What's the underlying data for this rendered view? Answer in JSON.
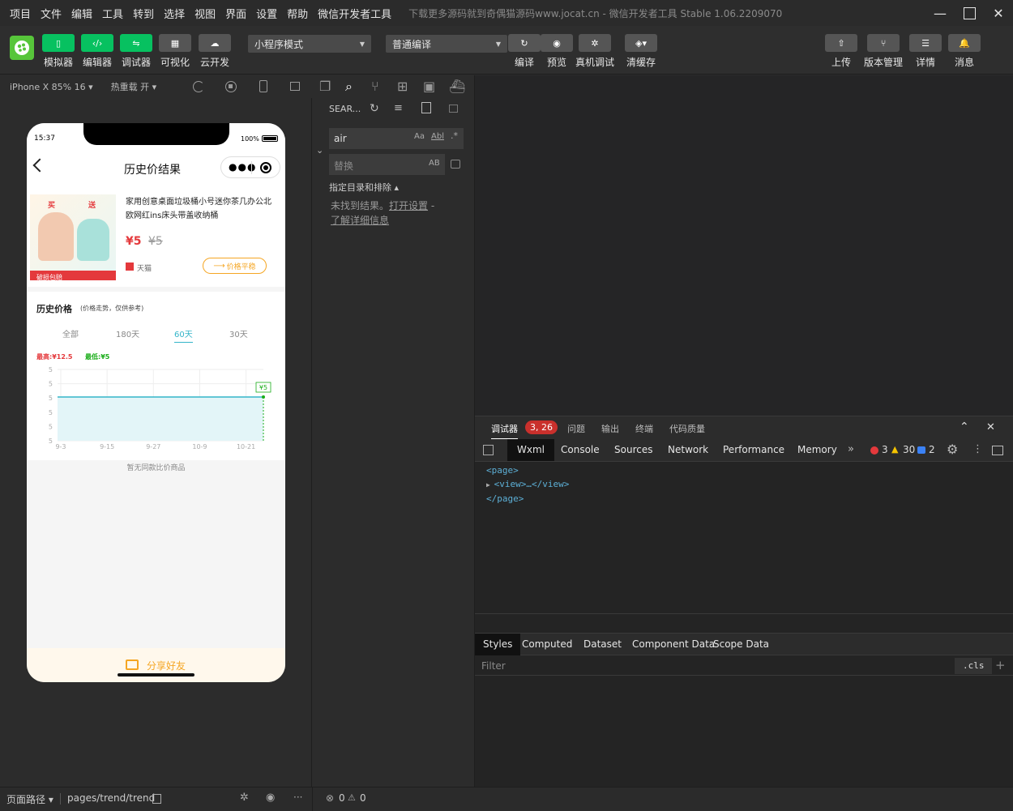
{
  "titlebar": {
    "menus": [
      "项目",
      "文件",
      "编辑",
      "工具",
      "转到",
      "选择",
      "视图",
      "界面",
      "设置",
      "帮助",
      "微信开发者工具"
    ],
    "title": "下载更多源码就到奇偶猫源码www.jocat.cn - 微信开发者工具 Stable 1.06.2209070"
  },
  "toolbar": {
    "left_buttons": [
      {
        "label": "模拟器",
        "icon": "phone-icon"
      },
      {
        "label": "编辑器",
        "icon": "code-icon"
      },
      {
        "label": "调试器",
        "icon": "debug-icon"
      },
      {
        "label": "可视化",
        "icon": "layout-icon"
      },
      {
        "label": "云开发",
        "icon": "cloud-icon"
      }
    ],
    "mode_select": "小程序模式",
    "compile_select": "普通编译",
    "mid_buttons": [
      {
        "label": "编译",
        "icon": "refresh-icon"
      },
      {
        "label": "预览",
        "icon": "eye-icon"
      },
      {
        "label": "真机调试",
        "icon": "bug-icon"
      },
      {
        "label": "清缓存",
        "icon": "layers-icon"
      }
    ],
    "right_buttons": [
      {
        "label": "上传",
        "icon": "upload-icon"
      },
      {
        "label": "版本管理",
        "icon": "branch-icon"
      },
      {
        "label": "详情",
        "icon": "menu-icon"
      },
      {
        "label": "消息",
        "icon": "bell-icon"
      }
    ]
  },
  "simulator": {
    "device": "iPhone X 85% 16 ▾",
    "hot_reload": "热重载 开 ▾"
  },
  "phone": {
    "time": "15:37",
    "battery": "100%",
    "page_title": "历史价结果",
    "product": {
      "name": "家用创意桌面垃圾桶小号迷你茶几办公北欧网红ins床头带盖收纳桶",
      "price": "¥5",
      "orig_price": "¥5",
      "shop": "天猫",
      "compare_btn": "价格平稳",
      "tag_buy": "买",
      "tag_send": "送",
      "tag_bottom": "破损包赔"
    },
    "history": {
      "title": "历史价格",
      "subtitle": "(价格走势，仅供参考)",
      "tabs": [
        "全部",
        "180天",
        "60天",
        "30天"
      ],
      "active_tab": 2,
      "max_label": "最高:¥12.5",
      "min_label": "最低:¥5",
      "no_compare": "暂无同款比价商品"
    },
    "share_label": "分享好友"
  },
  "chart_data": {
    "type": "line",
    "x": [
      "9-3",
      "9-15",
      "9-27",
      "10-9",
      "10-21"
    ],
    "yticks": [
      "5",
      "5",
      "5",
      "5",
      "5",
      "5"
    ],
    "series": [
      {
        "values": [
          5,
          5,
          5,
          5,
          5
        ]
      }
    ],
    "end_label": "¥5",
    "grid": true
  },
  "search": {
    "title": "SEAR...",
    "query": "air",
    "replace_placeholder": "替换",
    "opt_case": "Aa",
    "opt_word": "Abl",
    "opt_regex": ".*",
    "opt_preserve": "AB",
    "scope_toggle": "指定目录和排除 ▴",
    "no_result": "未找到结果。",
    "open_settings": "打开设置",
    "dash": "-",
    "learn_more": "了解详细信息"
  },
  "devtools": {
    "panel_tabs": [
      {
        "label": "调试器",
        "badge": "3, 26"
      },
      {
        "label": "问题"
      },
      {
        "label": "输出"
      },
      {
        "label": "终端"
      },
      {
        "label": "代码质量"
      }
    ],
    "tabs": [
      "Wxml",
      "Console",
      "Sources",
      "Network",
      "Performance",
      "Memory"
    ],
    "active_tab": "Wxml",
    "more": "»",
    "errors": "3",
    "warnings": "30",
    "infos": "2",
    "wxml_lines": [
      "<page>",
      "<view>…</view>",
      "</page>"
    ],
    "style_tabs": [
      "Styles",
      "Computed",
      "Dataset",
      "Component Data",
      "Scope Data"
    ],
    "filter_placeholder": "Filter",
    "cls": ".cls",
    "plus": "+"
  },
  "statusbar": {
    "path_label": "页面路径 ▾",
    "path": "pages/trend/trend",
    "errors": "0",
    "warnings": "0",
    "more": "···"
  },
  "colors": {
    "accent_green": "#07c160",
    "price_red": "#e4393c",
    "chart_line": "#34b5c9",
    "tab_active": "#1aad19"
  }
}
